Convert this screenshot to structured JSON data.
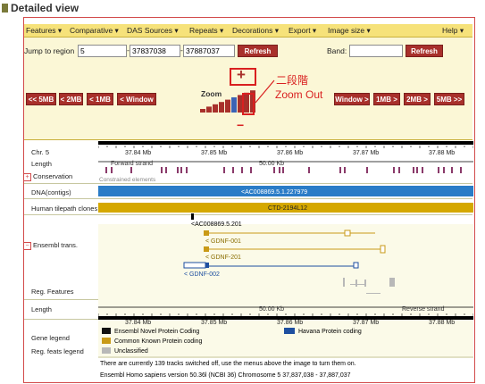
{
  "page_title": "Detailed view",
  "menu": [
    "Features ▾",
    "Comparative ▾",
    "DAS Sources ▾",
    "Repeats ▾",
    "Decorations ▾",
    "Export ▾",
    "Image size ▾",
    "Help ▾"
  ],
  "jump": {
    "label": "Jump to region",
    "chr": "5",
    "start": "37837038",
    "end": "37887037",
    "refresh": "Refresh"
  },
  "band": {
    "label": "Band:",
    "value": "",
    "refresh": "Refresh"
  },
  "nav_left": [
    "<< 5MB",
    "< 2MB",
    "< 1MB",
    "< Window"
  ],
  "nav_right": [
    "Window >",
    "1MB >",
    "2MB >",
    "5MB >>"
  ],
  "zoom_label": "Zoom",
  "zoom_level": 6,
  "zoom_steps": 9,
  "annotation": {
    "line1": "二段階",
    "line2": "Zoom Out",
    "plus": "+",
    "minus": "−"
  },
  "colors": {
    "accent": "#a8302b",
    "annotation": "#d92020",
    "ensembl_gene": "#c99a17",
    "novel": "#111111",
    "havana": "#1e4fa0",
    "contig": "#2a7cc7",
    "tilepath": "#d5a800",
    "conservation": "#8a3a6a"
  },
  "tracks": {
    "chr": "Chr. 5",
    "length": "Length",
    "conservation": "Conservation",
    "dna": "DNA(contigs)",
    "tilepath": "Human tilepath clones",
    "ensembl": "Ensembl trans.",
    "regfeat": "Reg. Features",
    "length2": "Length",
    "gene_legend": "Gene legend",
    "reg_legend": "Reg. feats legend"
  },
  "scale_ticks": [
    "37.84 Mb",
    "37.85 Mb",
    "37.86 Mb",
    "37.87 Mb",
    "37.88 Mb"
  ],
  "forward_strand": "Forward strand",
  "reverse_strand": "Reverse strand",
  "length_value": "50.00 Kb",
  "constrained": "Constrained elements",
  "contig": "<AC008869.5.1.227979",
  "clone": "CTD-2194L12",
  "transcripts": [
    "<AC008869.5.201",
    "< GDNF-001",
    "< GDNF-201",
    "< GDNF-002"
  ],
  "legend": {
    "novel": "Ensembl Novel Protein Coding",
    "havana": "Havana Protein coding",
    "known": "Common Known Protein coding",
    "unclassified": "Unclassified"
  },
  "footer1": "There are currently 139 tracks switched off, use the menus above the image to turn them on.",
  "footer2": "Ensembl Homo sapiens version 50.36l (NCBI 36) Chromosome 5 37,837,038 - 37,887,037"
}
